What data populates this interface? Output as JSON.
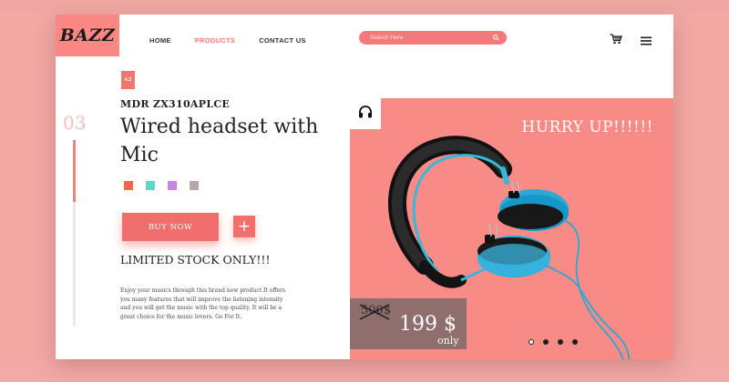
{
  "brand": {
    "logo": "BAZZ"
  },
  "nav": {
    "items": [
      {
        "label": "HOME",
        "active": false
      },
      {
        "label": "PRODUCTS",
        "active": true
      },
      {
        "label": "CONTACT US",
        "active": false
      }
    ]
  },
  "search": {
    "placeholder": "Search Here"
  },
  "header_icons": [
    "cart-icon",
    "menu-icon"
  ],
  "product": {
    "rating": "4.2",
    "model": "MDR ZX310APLCE",
    "title": "Wired headset with Mic",
    "slide_number": "03",
    "slide_progress": 0.33,
    "colors": [
      "#f2664a",
      "#5cd9c6",
      "#c986e0",
      "#b5a8aa"
    ],
    "buy_label": "BUY NOW",
    "add_label": "+",
    "stock_note": "LIMITED STOCK ONLY!!!",
    "description": "Enjoy your musics through this brand new product.It offers you many features that will improve the listening intensity and you will get the music with the top quality. It will be a great choice for the music lovers. Go For It."
  },
  "promo": {
    "headline": "HURRY UP!!!!!!",
    "old_price": "500$",
    "new_price": "199 $",
    "price_note": "only",
    "carousel_dots": 4,
    "carousel_active_index": 0
  },
  "colors": {
    "accent": "#f07e7a",
    "hero_bg": "#f88b86",
    "page_bg": "#f3a8a4",
    "price_box": "#8f6e6d"
  }
}
